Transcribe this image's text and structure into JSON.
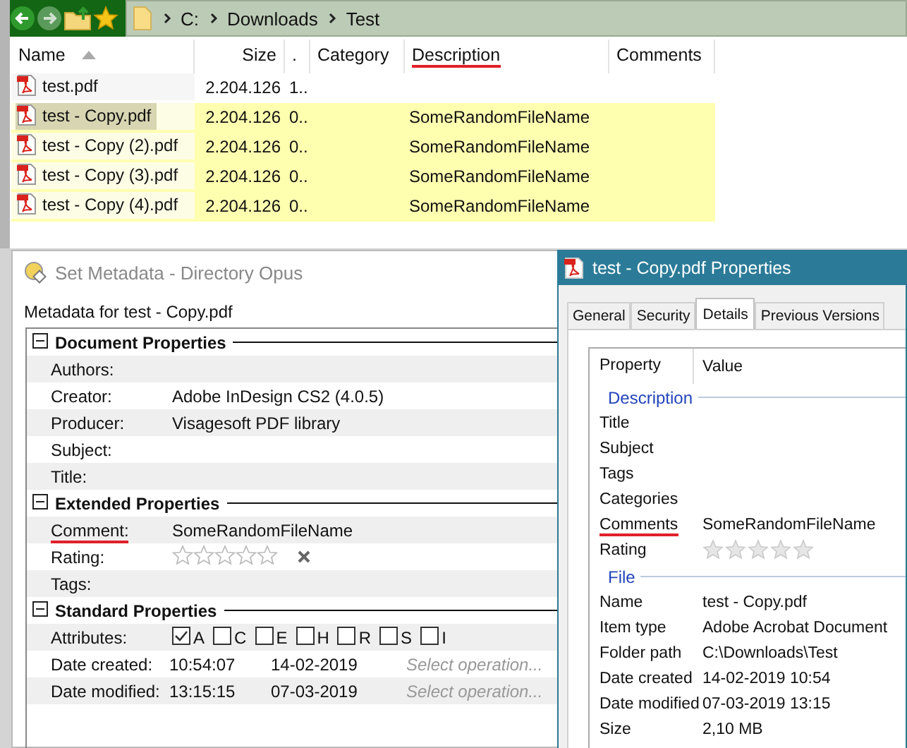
{
  "file_manager": {
    "breadcrumb": [
      "C:",
      "Downloads",
      "Test"
    ],
    "columns": [
      {
        "label": "Name",
        "sorted": true,
        "underlined": false
      },
      {
        "label": "Size",
        "sorted": false,
        "underlined": false
      },
      {
        "label": ".",
        "sorted": false,
        "underlined": false
      },
      {
        "label": "Category",
        "sorted": false,
        "underlined": false
      },
      {
        "label": "Description",
        "sorted": false,
        "underlined": true
      },
      {
        "label": "Comments",
        "sorted": false,
        "underlined": false
      }
    ],
    "rows": [
      {
        "cells": [
          "test.pdf",
          "2.204.126",
          "1..",
          "",
          "",
          ""
        ],
        "selected": false,
        "highlighted": false
      },
      {
        "cells": [
          "test - Copy.pdf",
          "2.204.126",
          "0..",
          "",
          "SomeRandomFileName",
          ""
        ],
        "selected": true,
        "highlighted": true
      },
      {
        "cells": [
          "test - Copy (2).pdf",
          "2.204.126",
          "0..",
          "",
          "SomeRandomFileName",
          ""
        ],
        "selected": false,
        "highlighted": true
      },
      {
        "cells": [
          "test - Copy (3).pdf",
          "2.204.126",
          "0..",
          "",
          "SomeRandomFileName",
          ""
        ],
        "selected": false,
        "highlighted": true
      },
      {
        "cells": [
          "test - Copy (4).pdf",
          "2.204.126",
          "0..",
          "",
          "SomeRandomFileName",
          ""
        ],
        "selected": false,
        "highlighted": true
      }
    ]
  },
  "metadata_dialog": {
    "title": "Set Metadata - Directory Opus",
    "subtitle": "Metadata for test - Copy.pdf",
    "sections": [
      {
        "title": "Document Properties",
        "expanded": true,
        "fields": [
          {
            "kind": "text",
            "label": "Authors:",
            "underlined": false
          },
          {
            "kind": "text",
            "label": "Creator:",
            "value": "Adobe InDesign CS2 (4.0.5)",
            "underlined": false
          },
          {
            "kind": "text",
            "label": "Producer:",
            "value": "Visagesoft PDF library",
            "underlined": false
          },
          {
            "kind": "text",
            "label": "Subject:",
            "underlined": false
          },
          {
            "kind": "text",
            "label": "Title:",
            "underlined": false
          }
        ]
      },
      {
        "title": "Extended Properties",
        "expanded": true,
        "fields": [
          {
            "kind": "text",
            "label": "Comment:",
            "value": "SomeRandomFileName",
            "underlined": true
          },
          {
            "kind": "rating",
            "label": "Rating:",
            "stars": 0,
            "underlined": false
          },
          {
            "kind": "text",
            "label": "Tags:",
            "underlined": false
          }
        ]
      },
      {
        "title": "Standard Properties",
        "expanded": true,
        "fields": [
          {
            "kind": "attributes",
            "label": "Attributes:",
            "underlined": false,
            "attributes": [
              {
                "letter": "A",
                "checked": true
              },
              {
                "letter": "C",
                "checked": false
              },
              {
                "letter": "E",
                "checked": false
              },
              {
                "letter": "H",
                "checked": false
              },
              {
                "letter": "R",
                "checked": false
              },
              {
                "letter": "S",
                "checked": false
              },
              {
                "letter": "I",
                "checked": false
              }
            ]
          },
          {
            "kind": "date",
            "label": "Date created:",
            "time": "10:54:07",
            "date": "14-02-2019",
            "placeholder": "Select operation...",
            "underlined": false
          },
          {
            "kind": "date",
            "label": "Date modified:",
            "time": "13:15:15",
            "date": "07-03-2019",
            "placeholder": "Select operation...",
            "underlined": false
          }
        ]
      }
    ]
  },
  "properties_window": {
    "title": "test - Copy.pdf Properties",
    "tabs": [
      {
        "label": "General",
        "selected": false
      },
      {
        "label": "Security",
        "selected": false
      },
      {
        "label": "Details",
        "selected": true
      },
      {
        "label": "Previous Versions",
        "selected": false
      }
    ],
    "columns": [
      "Property",
      "Value"
    ],
    "groups": [
      {
        "title": "Description",
        "items": [
          {
            "kind": "text",
            "label": "Title",
            "underlined": false
          },
          {
            "kind": "text",
            "label": "Subject",
            "underlined": false
          },
          {
            "kind": "text",
            "label": "Tags",
            "underlined": false
          },
          {
            "kind": "text",
            "label": "Categories",
            "underlined": false
          },
          {
            "kind": "text",
            "label": "Comments",
            "value": "SomeRandomFileName",
            "underlined": true
          },
          {
            "kind": "rating",
            "label": "Rating",
            "stars": 0,
            "underlined": false
          }
        ]
      },
      {
        "title": "File",
        "items": [
          {
            "kind": "text",
            "label": "Name",
            "value": "test - Copy.pdf",
            "underlined": false
          },
          {
            "kind": "text",
            "label": "Item type",
            "value": "Adobe Acrobat Document",
            "underlined": false
          },
          {
            "kind": "text",
            "label": "Folder path",
            "value": "C:\\Downloads\\Test",
            "underlined": false
          },
          {
            "kind": "text",
            "label": "Date created",
            "value": "14-02-2019 10:54",
            "underlined": false
          },
          {
            "kind": "text",
            "label": "Date modified",
            "value": "07-03-2019 13:15",
            "underlined": false
          },
          {
            "kind": "text",
            "label": "Size",
            "value": "2,10 MB",
            "underlined": false
          }
        ]
      }
    ]
  }
}
